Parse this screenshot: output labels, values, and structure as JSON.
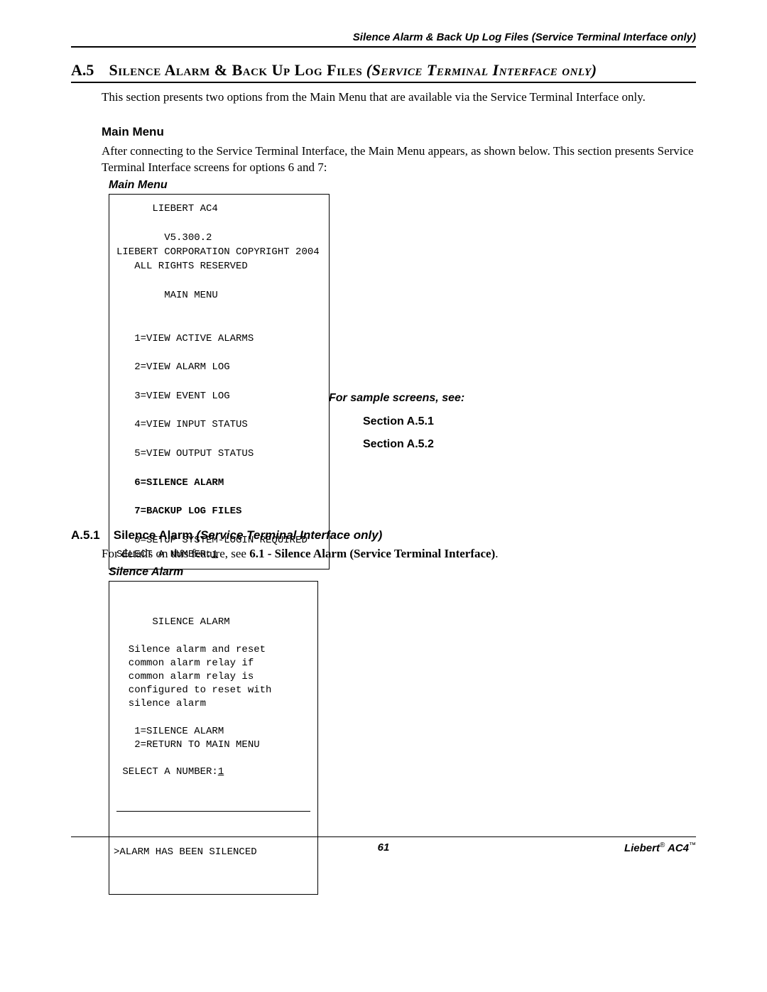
{
  "header": {
    "running_title": "Silence Alarm & Back Up Log Files (Service Terminal Interface only)"
  },
  "section": {
    "number": "A.5",
    "title_caps": "Silence Alarm & Back Up Log Files",
    "title_italic": "(Service Terminal Interface only)"
  },
  "intro": "This section presents two options from the Main Menu that are available via the Service Terminal Interface only.",
  "main_menu": {
    "label": "Main Menu",
    "desc": "After connecting to the Service Terminal Interface, the Main Menu appears, as shown below. This section presents Service Terminal Interface screens for options 6 and 7:",
    "box_label": "Main Menu",
    "line_product": "      LIEBERT AC4",
    "line_version": "        V5.300.2",
    "line_copyright": "LIEBERT CORPORATION COPYRIGHT 2004",
    "line_rights": "   ALL RIGHTS RESERVED",
    "line_mm": "        MAIN MENU",
    "opt1": "   1=VIEW ACTIVE ALARMS",
    "opt2": "   2=VIEW ALARM LOG",
    "opt3": "   3=VIEW EVENT LOG",
    "opt4": "   4=VIEW INPUT STATUS",
    "opt5": "   5=VIEW OUTPUT STATUS",
    "opt6": "   6=SILENCE ALARM",
    "opt7": "   7=BACKUP LOG FILES",
    "opt0": "   0=SETUP SYSTEM-LOGIN REQUIRED",
    "prompt": "SELECT A NUMBER:",
    "prompt_value": "1"
  },
  "sample": {
    "label": "For sample screens, see:",
    "ref1": "Section A.5.1",
    "ref2": "Section A.5.2"
  },
  "subsection": {
    "number": "A.5.1",
    "title": "Silence Alarm",
    "title_italic": "(Service Terminal Interface only)",
    "desc_prefix": "For details on this feature, see ",
    "desc_bold": "6.1 - Silence Alarm (Service Terminal Interface)",
    "desc_suffix": "."
  },
  "silence_alarm": {
    "box_label": "Silence Alarm",
    "title": "      SILENCE ALARM",
    "body1": "  Silence alarm and reset",
    "body2": "  common alarm relay if",
    "body3": "  common alarm relay is",
    "body4": "  configured to reset with",
    "body5": "  silence alarm",
    "choice1": "   1=SILENCE ALARM",
    "choice2": "   2=RETURN TO MAIN MENU",
    "prompt": " SELECT A NUMBER:",
    "prompt_value": "1",
    "result": ">ALARM HAS BEEN SILENCED"
  },
  "footer": {
    "page": "61",
    "product_brand": "Liebert",
    "product_model": "AC4"
  }
}
